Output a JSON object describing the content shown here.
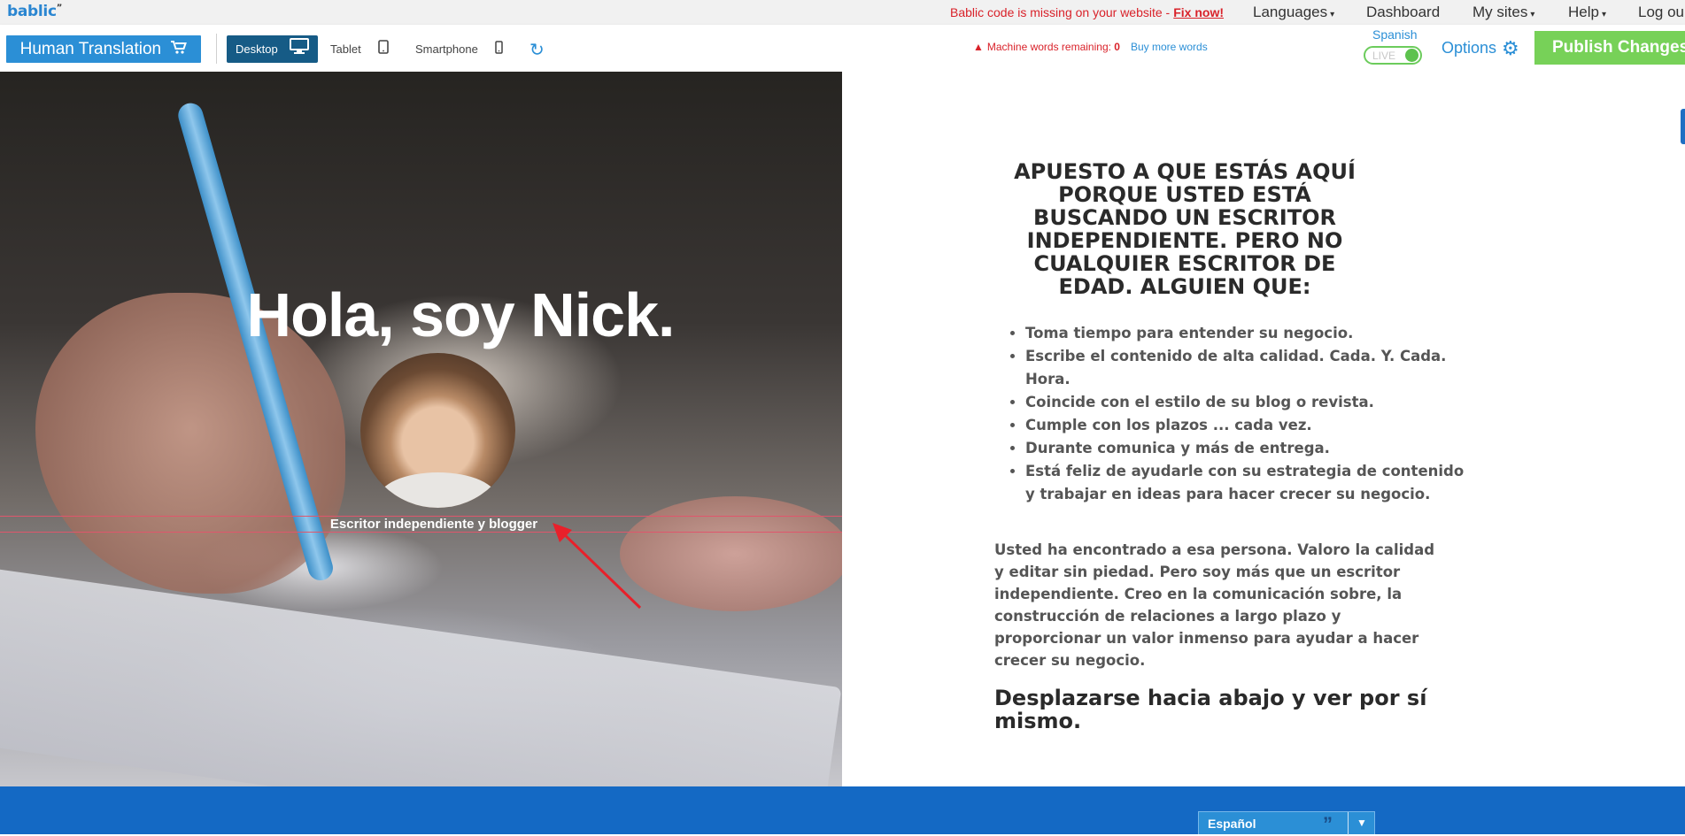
{
  "topbar": {
    "logo": "bablic",
    "logo_mark": "”",
    "missing_text": "Bablic code is missing on your website -",
    "fix_link": "Fix now!",
    "nav": [
      {
        "label": "Languages",
        "caret": "▾"
      },
      {
        "label": "Dashboard",
        "caret": ""
      },
      {
        "label": "My sites",
        "caret": "▾"
      },
      {
        "label": "Help",
        "caret": "▾"
      },
      {
        "label": "Log ou",
        "caret": ""
      }
    ]
  },
  "toolbar": {
    "human_translation": "Human Translation",
    "devices": [
      {
        "label": "Desktop",
        "icon": "monitor-icon",
        "active": true
      },
      {
        "label": "Tablet",
        "icon": "tablet-icon",
        "active": false
      },
      {
        "label": "Smartphone",
        "icon": "smartphone-icon",
        "active": false
      }
    ],
    "refresh_icon": "↻",
    "machine_words_label": "Machine words remaining:",
    "machine_words_value": "0",
    "buy_more": "Buy more words",
    "language": "Spanish",
    "live_label": "LIVE",
    "options": "Options",
    "publish": "Publish Changes"
  },
  "hero": {
    "title": "Hola, soy Nick.",
    "subtitle": "Escritor independiente y blogger"
  },
  "content": {
    "heading": "APUESTO A QUE ESTÁS AQUÍ PORQUE USTED ESTÁ BUSCANDO UN ESCRITOR INDEPENDIENTE. PERO NO CUALQUIER ESCRITOR DE EDAD. ALGUIEN QUE:",
    "bullets": [
      "Toma tiempo para entender su negocio.",
      "Escribe el contenido de alta calidad. Cada. Y. Cada. Hora.",
      "Coincide con el estilo de su blog o revista.",
      "Cumple con los plazos ... cada vez.",
      "Durante comunica y más de entrega.",
      "Está feliz de ayudarle con su estrategia de contenido y trabajar en ideas para hacer crecer su negocio."
    ],
    "paragraph": "Usted ha encontrado a esa persona. Valoro la calidad y editar sin piedad. Pero soy más que un escritor independiente. Creo en la comunicación sobre, la construcción de relaciones a largo plazo y proporcionar un valor inmenso para ayudar a hacer crecer su negocio.",
    "cta": "Desplazarse hacia abajo y ver por sí mismo."
  },
  "footer": {
    "language_select": "Español",
    "quote_icon": "”",
    "arrow": "▼"
  },
  "colors": {
    "brand_blue": "#2b8fd6",
    "publish_green": "#77d158",
    "warning_red": "#d9222a",
    "footer_blue": "#1469c4",
    "annotation_arrow": "#e8202a"
  }
}
